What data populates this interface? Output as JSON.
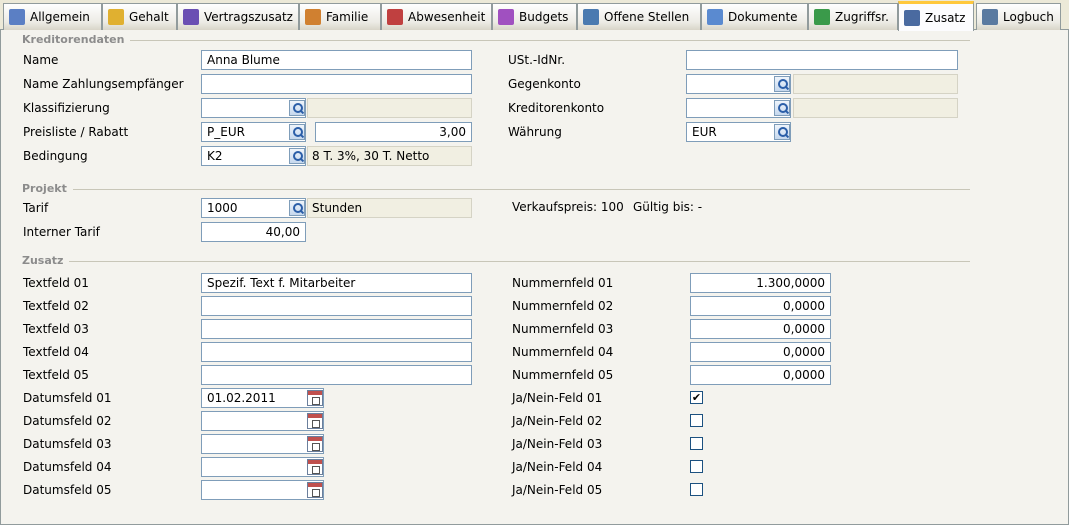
{
  "tabs": [
    {
      "label": "Allgemein",
      "icon": "person-search-icon",
      "color": "#5b7fc4"
    },
    {
      "label": "Gehalt",
      "icon": "coins-icon",
      "color": "#e0b030"
    },
    {
      "label": "Vertragszusatz",
      "icon": "hash-doc-icon",
      "color": "#6a4fb3"
    },
    {
      "label": "Familie",
      "icon": "family-icon",
      "color": "#d08030"
    },
    {
      "label": "Abwesenheit",
      "icon": "absence-icon",
      "color": "#c04040"
    },
    {
      "label": "Budgets",
      "icon": "budget-icon",
      "color": "#a050c0"
    },
    {
      "label": "Offene Stellen",
      "icon": "vacancy-icon",
      "color": "#4a7ab0"
    },
    {
      "label": "Dokumente",
      "icon": "documents-icon",
      "color": "#5a8ad0"
    },
    {
      "label": "Zugriffsr.",
      "icon": "access-rights-icon",
      "color": "#3a9a4a"
    },
    {
      "label": "Zusatz",
      "icon": "extra-person-icon",
      "color": "#4a6aa0"
    },
    {
      "label": "Logbuch",
      "icon": "logbook-icon",
      "color": "#5a7aa0"
    }
  ],
  "sections": {
    "kreditor": "Kreditorendaten",
    "projekt": "Projekt",
    "zusatz": "Zusatz"
  },
  "kreditor": {
    "name_label": "Name",
    "name_value": "Anna Blume",
    "payee_label": "Name Zahlungsempfänger",
    "payee_value": "",
    "class_label": "Klassifizierung",
    "class_value": "",
    "price_label": "Preisliste / Rabatt",
    "price_value": "P_EUR",
    "discount_value": "3,00",
    "cond_label": "Bedingung",
    "cond_value": "K2",
    "cond_desc": "8 T. 3%, 30 T. Netto",
    "vat_label": "USt.-IdNr.",
    "vat_value": "",
    "contra_label": "Gegenkonto",
    "contra_value": "",
    "account_label": "Kreditorenkonto",
    "account_value": "",
    "currency_label": "Währung",
    "currency_value": "EUR"
  },
  "projekt": {
    "tarif_label": "Tarif",
    "tarif_value": "1000",
    "tarif_unit": "Stunden",
    "internal_label": "Interner Tarif",
    "internal_value": "40,00",
    "sales_info": "Verkaufspreis: 100",
    "valid_info": "Gültig bis: -"
  },
  "zusatz": {
    "text_fields": [
      {
        "label": "Textfeld 01",
        "value": "Spezif. Text f. Mitarbeiter"
      },
      {
        "label": "Textfeld 02",
        "value": ""
      },
      {
        "label": "Textfeld 03",
        "value": ""
      },
      {
        "label": "Textfeld 04",
        "value": ""
      },
      {
        "label": "Textfeld 05",
        "value": ""
      }
    ],
    "date_fields": [
      {
        "label": "Datumsfeld 01",
        "value": "01.02.2011"
      },
      {
        "label": "Datumsfeld 02",
        "value": ""
      },
      {
        "label": "Datumsfeld 03",
        "value": ""
      },
      {
        "label": "Datumsfeld 04",
        "value": ""
      },
      {
        "label": "Datumsfeld 05",
        "value": ""
      }
    ],
    "number_fields": [
      {
        "label": "Nummernfeld 01",
        "value": "1.300,0000"
      },
      {
        "label": "Nummernfeld 02",
        "value": "0,0000"
      },
      {
        "label": "Nummernfeld 03",
        "value": "0,0000"
      },
      {
        "label": "Nummernfeld 04",
        "value": "0,0000"
      },
      {
        "label": "Nummernfeld 05",
        "value": "0,0000"
      }
    ],
    "bool_fields": [
      {
        "label": "Ja/Nein-Feld 01",
        "checked": true
      },
      {
        "label": "Ja/Nein-Feld 02",
        "checked": false
      },
      {
        "label": "Ja/Nein-Feld 03",
        "checked": false
      },
      {
        "label": "Ja/Nein-Feld 04",
        "checked": false
      },
      {
        "label": "Ja/Nein-Feld 05",
        "checked": false
      }
    ]
  }
}
